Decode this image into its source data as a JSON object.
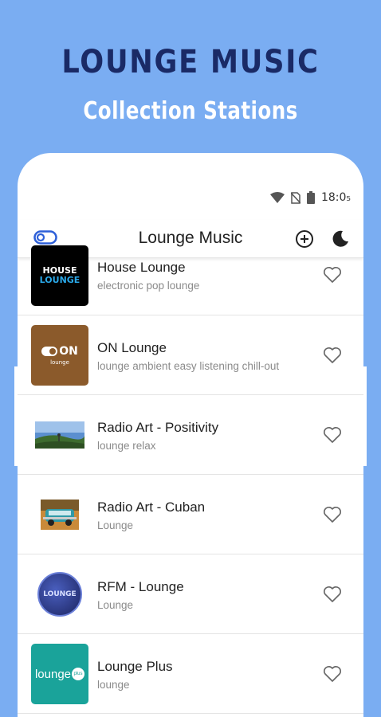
{
  "promo": {
    "title": "LOUNGE MUSIC",
    "subtitle": "Collection Stations"
  },
  "status_bar": {
    "time": "18:0₅",
    "icons": [
      "wifi-icon",
      "no-sim-icon",
      "battery-icon"
    ]
  },
  "app_bar": {
    "title": "Lounge Music",
    "icons": [
      "toggle-icon",
      "add-circle-icon",
      "moon-icon"
    ]
  },
  "stations": [
    {
      "name": "House Lounge",
      "tags": "electronic pop lounge",
      "logo_text_1": "HOUSE",
      "logo_text_2": "LOUNGE",
      "icon": "heart-outline-icon"
    },
    {
      "name": "ON Lounge",
      "tags": "lounge ambient easy listening chill-out",
      "logo_text_1": "ON",
      "logo_text_2": "lounge",
      "icon": "heart-outline-icon"
    },
    {
      "name": "Radio Art - Positivity",
      "tags": "lounge relax",
      "icon": "heart-outline-icon"
    },
    {
      "name": "Radio Art - Cuban",
      "tags": "Lounge",
      "icon": "heart-outline-icon"
    },
    {
      "name": "RFM - Lounge",
      "tags": "Lounge",
      "logo_text_1": "LOUNGE",
      "icon": "heart-outline-icon"
    },
    {
      "name": "Lounge Plus",
      "tags": "lounge",
      "logo_text_1": "lounge",
      "logo_text_2": "plus",
      "icon": "heart-outline-icon"
    }
  ],
  "colors": {
    "background": "#7aadf2",
    "title": "#1a2a66",
    "accent_blue": "#2d5fd8",
    "on_lounge_brown": "#8b5a2b",
    "lounge_plus_teal": "#1aa39a"
  }
}
